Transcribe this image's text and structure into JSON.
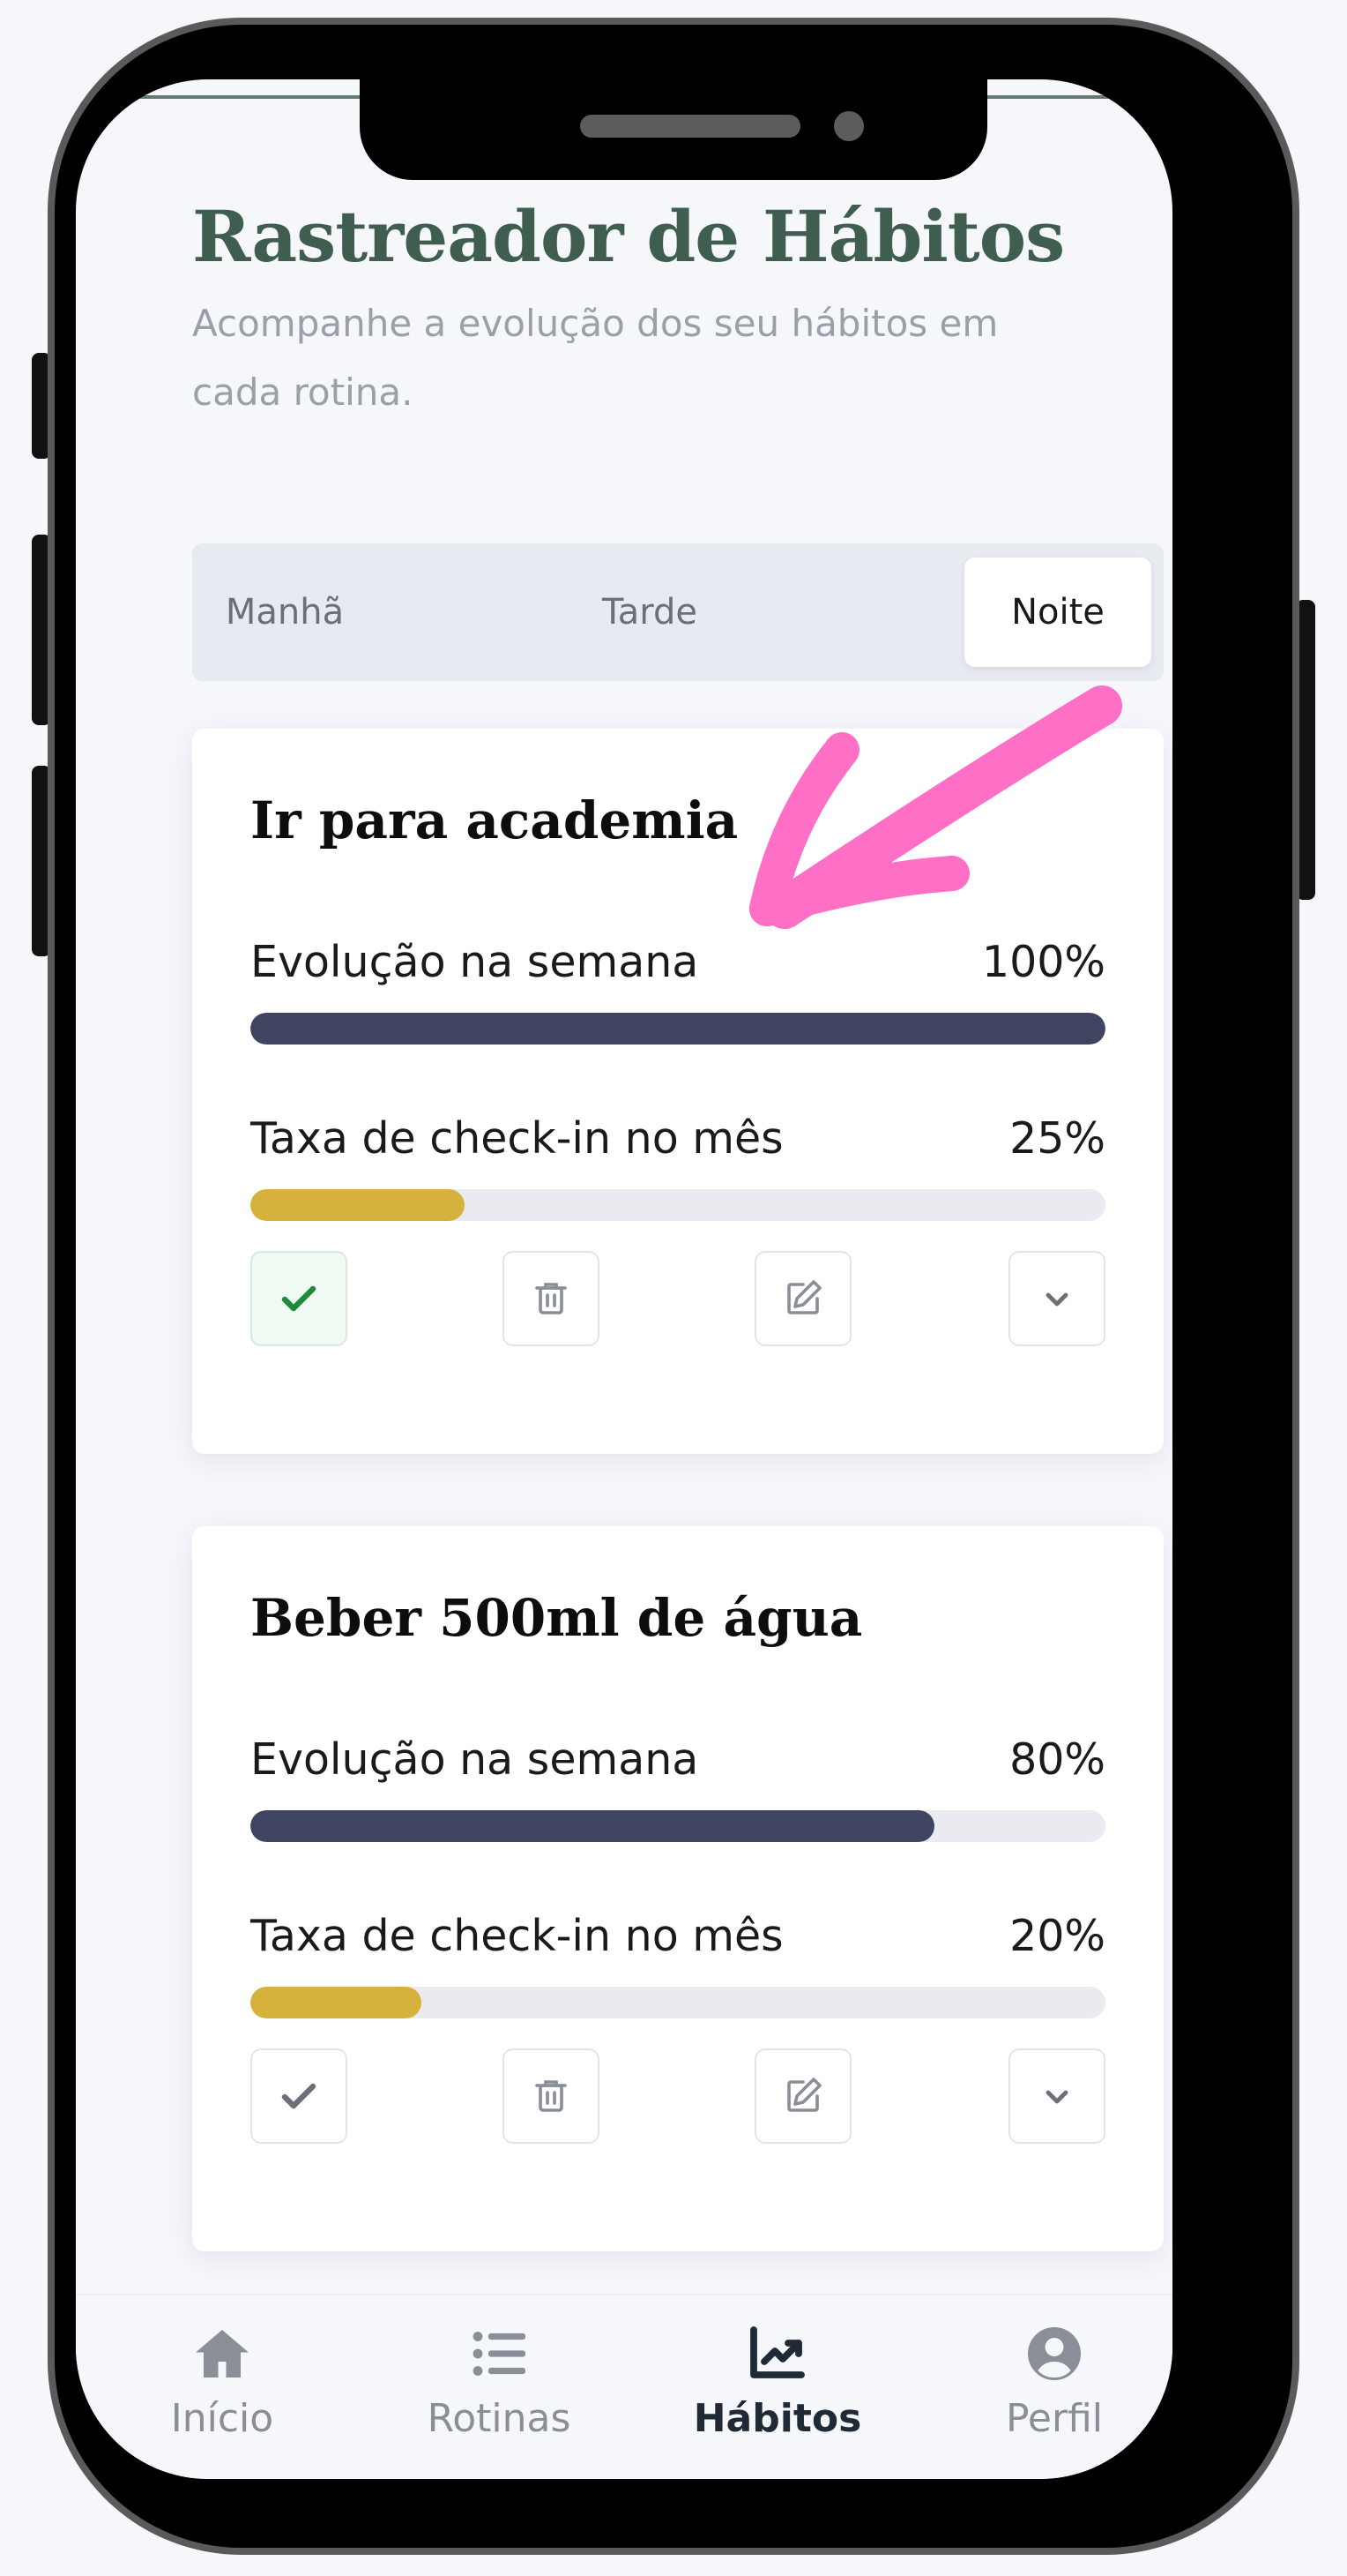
{
  "header": {
    "title": "Rastreador de Hábitos",
    "subtitle": "Acompanhe a evolução dos seu hábitos em cada rotina."
  },
  "tabs": [
    {
      "label": "Manhã",
      "active": false
    },
    {
      "label": "Tarde",
      "active": false
    },
    {
      "label": "Noite",
      "active": true
    }
  ],
  "habits": [
    {
      "title": "Ir para academia",
      "week_label": "Evolução na semana",
      "week_value": "100%",
      "week_fraction": 1.0,
      "month_label": "Taxa de check-in no mês",
      "month_value": "25%",
      "month_fraction": 0.25,
      "checked": true
    },
    {
      "title": "Beber 500ml de água",
      "week_label": "Evolução na semana",
      "week_value": "80%",
      "week_fraction": 0.8,
      "month_label": "Taxa de check-in no mês",
      "month_value": "20%",
      "month_fraction": 0.2,
      "checked": false
    }
  ],
  "actions": {
    "icons": [
      "check-icon",
      "trash-icon",
      "edit-icon",
      "chevron-down-icon"
    ]
  },
  "nav": [
    {
      "label": "Início",
      "icon": "home-icon",
      "active": false
    },
    {
      "label": "Rotinas",
      "icon": "list-icon",
      "active": false
    },
    {
      "label": "Hábitos",
      "icon": "chart-line-icon",
      "active": true
    },
    {
      "label": "Perfil",
      "icon": "user-circle-icon",
      "active": false
    }
  ],
  "colors": {
    "title": "#3f5e50",
    "week_bar": "#3f4561",
    "month_bar": "#d6b23c",
    "check_done": "#1f8a3b",
    "annotation_arrow": "#ff6fc5"
  }
}
